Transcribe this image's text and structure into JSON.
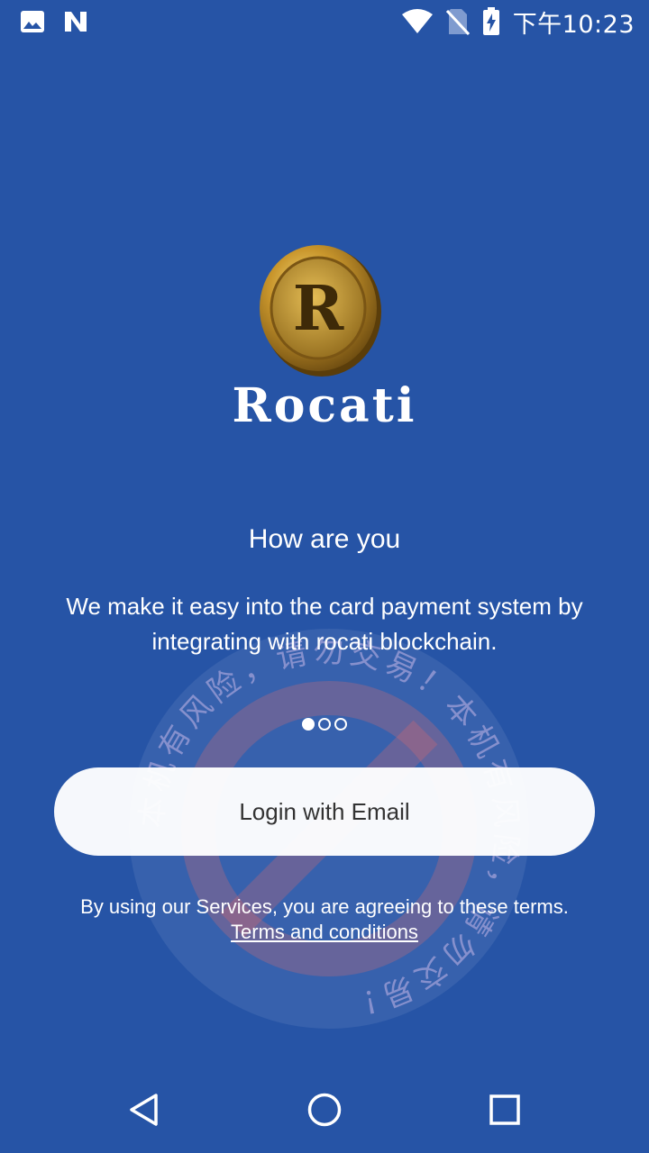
{
  "status_bar": {
    "time": "下午10:23",
    "icons": [
      "image-icon",
      "n-icon",
      "wifi-icon",
      "no-sim-icon",
      "battery-charging-icon"
    ]
  },
  "logo": {
    "coin_letter": "R",
    "brand": "Rocati"
  },
  "onboarding": {
    "heading": "How are you",
    "description": "We make it easy into the card payment system by integrating with rocati blockchain.",
    "pages_total": 3,
    "current_page": 1
  },
  "login_button": {
    "label": "Login with Email"
  },
  "terms": {
    "text": "By using our Services, you are agreeing to these terms.",
    "link_label": "Terms and conditions"
  },
  "watermark": {
    "text": "本机有风险，请勿交易！本机有风险，请勿交易！"
  },
  "nav_bar": {
    "icons": [
      "back-icon",
      "home-icon",
      "recents-icon"
    ]
  },
  "colors": {
    "background": "#2654a6",
    "button_bg": "#ffffff",
    "button_text": "#333333",
    "watermark": "#b0a0d8"
  }
}
